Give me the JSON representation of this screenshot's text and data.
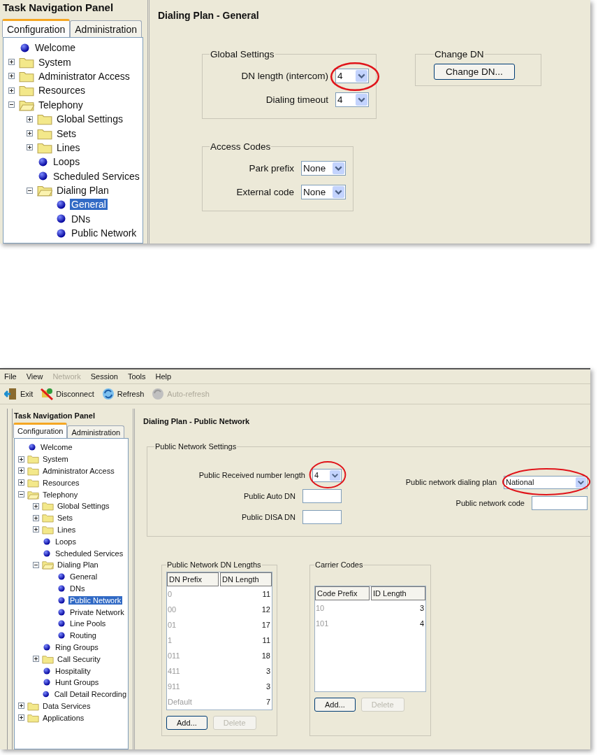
{
  "general_screen": {
    "nav": {
      "title": "Task Navigation Panel",
      "tabs": [
        {
          "label": "Configuration",
          "selected": true
        },
        {
          "label": "Administration",
          "selected": false
        }
      ],
      "tree": [
        {
          "label": "Welcome",
          "kind": "leaf",
          "selected": false
        },
        {
          "label": "System",
          "kind": "folder",
          "expanded": false,
          "selected": false
        },
        {
          "label": "Administrator Access",
          "kind": "folder",
          "expanded": false,
          "selected": false
        },
        {
          "label": "Resources",
          "kind": "folder",
          "expanded": false,
          "selected": false
        },
        {
          "label": "Telephony",
          "kind": "folder",
          "expanded": true,
          "selected": false,
          "children": [
            {
              "label": "Global Settings",
              "kind": "folder",
              "expanded": false,
              "selected": false
            },
            {
              "label": "Sets",
              "kind": "folder",
              "expanded": false,
              "selected": false
            },
            {
              "label": "Lines",
              "kind": "folder",
              "expanded": false,
              "selected": false
            },
            {
              "label": "Loops",
              "kind": "leaf",
              "selected": false
            },
            {
              "label": "Scheduled Services",
              "kind": "leaf",
              "selected": false
            },
            {
              "label": "Dialing Plan",
              "kind": "folder",
              "expanded": true,
              "selected": false,
              "children": [
                {
                  "label": "General",
                  "kind": "leaf",
                  "selected": true
                },
                {
                  "label": "DNs",
                  "kind": "leaf",
                  "selected": false
                },
                {
                  "label": "Public Network",
                  "kind": "leaf",
                  "selected": false
                }
              ]
            }
          ]
        }
      ]
    },
    "title": "Dialing Plan - General",
    "global_settings": {
      "title": "Global Settings",
      "fields": [
        {
          "label": "DN length (intercom)",
          "kind": "dropdown",
          "value": "4",
          "highlighted": true
        },
        {
          "label": "Dialing timeout",
          "kind": "dropdown",
          "value": "4",
          "highlighted": false
        }
      ]
    },
    "change_dn": {
      "title": "Change DN",
      "button": "Change DN..."
    },
    "access_codes": {
      "title": "Access Codes",
      "fields": [
        {
          "label": "Park prefix",
          "kind": "dropdown",
          "value": "None",
          "highlighted": false
        },
        {
          "label": "External code",
          "kind": "dropdown",
          "value": "None",
          "highlighted": false
        }
      ]
    }
  },
  "public_network_screen": {
    "menu": [
      {
        "label": "File",
        "disabled": false
      },
      {
        "label": "View",
        "disabled": false
      },
      {
        "label": "Network",
        "disabled": true
      },
      {
        "label": "Session",
        "disabled": false
      },
      {
        "label": "Tools",
        "disabled": false
      },
      {
        "label": "Help",
        "disabled": false
      }
    ],
    "toolbar": [
      {
        "label": "Exit",
        "kind": "exit",
        "disabled": false
      },
      {
        "label": "Disconnect",
        "kind": "disconnect",
        "disabled": false
      },
      {
        "label": "Refresh",
        "kind": "refresh",
        "disabled": false
      },
      {
        "label": "Auto-refresh",
        "kind": "auto",
        "disabled": true
      }
    ],
    "nav": {
      "title": "Task Navigation Panel",
      "tabs": [
        {
          "label": "Configuration",
          "selected": true
        },
        {
          "label": "Administration",
          "selected": false
        }
      ],
      "tree": [
        {
          "label": "Welcome",
          "kind": "leaf",
          "selected": false
        },
        {
          "label": "System",
          "kind": "folder",
          "expanded": false,
          "selected": false
        },
        {
          "label": "Administrator Access",
          "kind": "folder",
          "expanded": false,
          "selected": false
        },
        {
          "label": "Resources",
          "kind": "folder",
          "expanded": false,
          "selected": false
        },
        {
          "label": "Telephony",
          "kind": "folder",
          "expanded": true,
          "selected": false,
          "children": [
            {
              "label": "Global Settings",
              "kind": "folder",
              "expanded": false,
              "selected": false
            },
            {
              "label": "Sets",
              "kind": "folder",
              "expanded": false,
              "selected": false
            },
            {
              "label": "Lines",
              "kind": "folder",
              "expanded": false,
              "selected": false
            },
            {
              "label": "Loops",
              "kind": "leaf",
              "selected": false
            },
            {
              "label": "Scheduled Services",
              "kind": "leaf",
              "selected": false
            },
            {
              "label": "Dialing Plan",
              "kind": "folder",
              "expanded": true,
              "selected": false,
              "children": [
                {
                  "label": "General",
                  "kind": "leaf",
                  "selected": false
                },
                {
                  "label": "DNs",
                  "kind": "leaf",
                  "selected": false
                },
                {
                  "label": "Public Network",
                  "kind": "leaf",
                  "selected": true
                },
                {
                  "label": "Private Network",
                  "kind": "leaf",
                  "selected": false
                },
                {
                  "label": "Line Pools",
                  "kind": "leaf",
                  "selected": false
                },
                {
                  "label": "Routing",
                  "kind": "leaf",
                  "selected": false
                }
              ]
            },
            {
              "label": "Ring Groups",
              "kind": "leaf",
              "selected": false
            },
            {
              "label": "Call Security",
              "kind": "folder",
              "expanded": false,
              "selected": false
            },
            {
              "label": "Hospitality",
              "kind": "leaf",
              "selected": false
            },
            {
              "label": "Hunt Groups",
              "kind": "leaf",
              "selected": false
            },
            {
              "label": "Call Detail Recording",
              "kind": "leaf",
              "selected": false
            }
          ]
        },
        {
          "label": "Data Services",
          "kind": "folder",
          "expanded": false,
          "selected": false
        },
        {
          "label": "Applications",
          "kind": "folder",
          "expanded": false,
          "selected": false
        }
      ]
    },
    "title": "Dialing Plan - Public Network",
    "settings": {
      "title": "Public Network Settings",
      "left_fields": [
        {
          "label": "Public Received number length",
          "kind": "dropdown",
          "value": "4",
          "highlighted": true
        },
        {
          "label": "Public Auto DN",
          "kind": "text"
        },
        {
          "label": "Public DISA DN",
          "kind": "text"
        }
      ],
      "right_fields": [
        {
          "label": "Public network dialing plan",
          "kind": "dropdown",
          "value": "National",
          "highlighted": true
        },
        {
          "label": "Public network code",
          "kind": "text"
        }
      ]
    },
    "tables": [
      {
        "title": "Public Network DN Lengths",
        "columns": [
          "DN Prefix",
          "DN Length"
        ],
        "rows": [
          [
            "0",
            "11"
          ],
          [
            "00",
            "12"
          ],
          [
            "01",
            "17"
          ],
          [
            "1",
            "11"
          ],
          [
            "011",
            "18"
          ],
          [
            "411",
            "3"
          ],
          [
            "911",
            "3"
          ],
          [
            "Default",
            "7"
          ]
        ],
        "buttons": [
          {
            "label": "Add...",
            "disabled": false
          },
          {
            "label": "Delete",
            "disabled": true
          }
        ]
      },
      {
        "title": "Carrier Codes",
        "columns": [
          "Code Prefix",
          "ID Length"
        ],
        "rows": [
          [
            "10",
            "3"
          ],
          [
            "101",
            "4"
          ]
        ],
        "buttons": [
          {
            "label": "Add...",
            "disabled": false
          },
          {
            "label": "Delete",
            "disabled": true
          }
        ]
      }
    ]
  }
}
